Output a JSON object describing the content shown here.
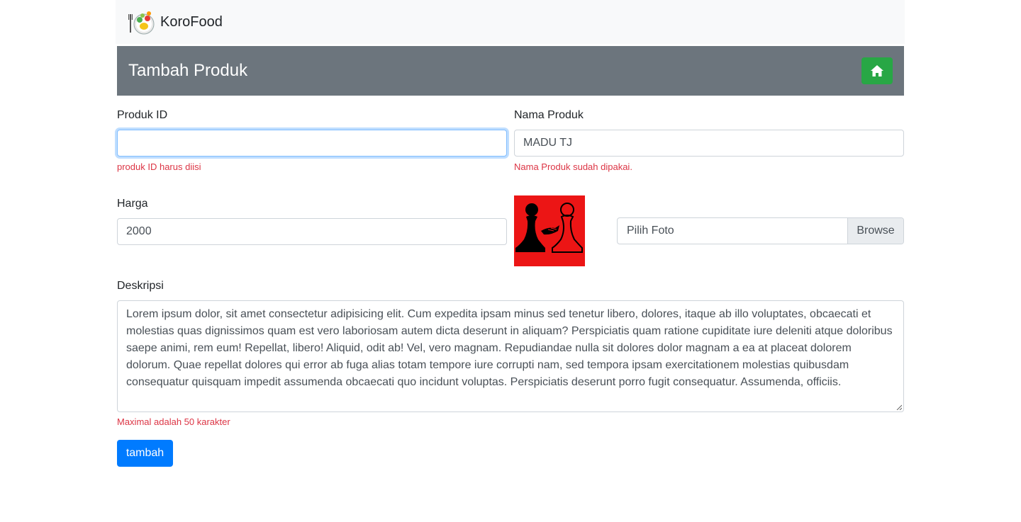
{
  "navbar": {
    "brand": "KoroFood",
    "logo_icon": "food-bowl-icon"
  },
  "header": {
    "title": "Tambah Produk",
    "home_icon": "home-icon",
    "home_color": "#28a745",
    "bar_color": "#6c757d"
  },
  "form": {
    "produk_id": {
      "label": "Produk ID",
      "value": "",
      "error": "produk ID harus diisi"
    },
    "nama_produk": {
      "label": "Nama Produk",
      "value": "MADU TJ",
      "error": "Nama Produk sudah dipakai."
    },
    "harga": {
      "label": "Harga",
      "value": "2000"
    },
    "foto": {
      "preview_icon": "chess-pawns-handshake-image",
      "label": "Pilih Foto",
      "browse": "Browse"
    },
    "deskripsi": {
      "label": "Deskripsi",
      "value": "Lorem ipsum dolor, sit amet consectetur adipisicing elit. Cum expedita ipsam minus sed tenetur libero, dolores, itaque ab illo voluptates, obcaecati et molestias quas dignissimos quam est vero laboriosam autem dicta deserunt in aliquam? Perspiciatis quam ratione cupiditate iure deleniti atque doloribus saepe animi, rem eum! Repellat, libero! Aliquid, odit ab! Vel, vero magnam. Repudiandae nulla sit dolores dolor magnam a ea at placeat dolorem dolorum. Quae repellat dolores qui error ab fuga alias totam tempore iure corrupti nam, sed tempora ipsam exercitationem molestias quibusdam consequatur quisquam impedit assumenda obcaecati quo incidunt voluptas. Perspiciatis deserunt porro fugit consequatur. Assumenda, officiis.",
      "error": "Maximal adalah 50 karakter"
    },
    "submit": "tambah"
  },
  "colors": {
    "error": "#dc3545",
    "primary": "#007bff"
  }
}
